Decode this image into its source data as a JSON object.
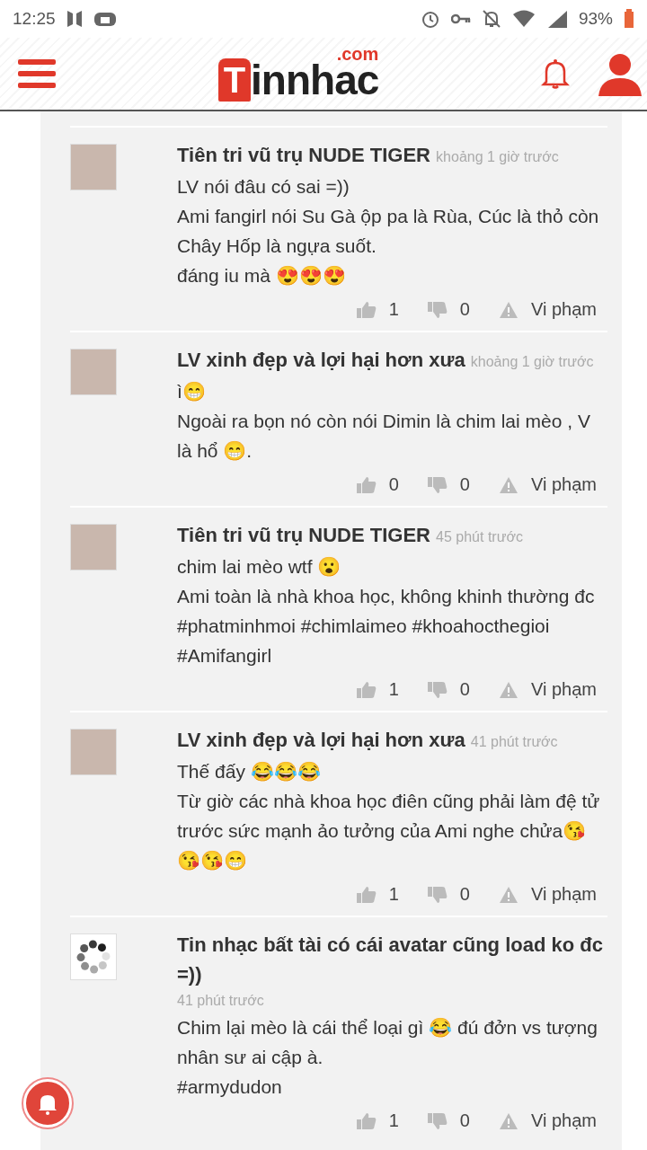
{
  "status_bar": {
    "time": "12:25",
    "battery": "93%"
  },
  "header": {
    "logo": {
      "mark": "T",
      "name": "innhac",
      "suffix": ".com"
    }
  },
  "comments": [
    {
      "author": "Tiên tri vũ trụ NUDE TIGER",
      "time": "khoảng 1 giờ trước",
      "avatar": {
        "kind": "photo"
      },
      "lines": [
        "LV nói đâu có sai =))",
        "Ami fangirl nói Su Gà ộp pa là Rùa, Cúc là thỏ còn Chây Hốp là ngựa suốt.",
        "đáng iu mà 😍😍😍"
      ],
      "likes": "1",
      "dislikes": "0",
      "report": "Vi phạm"
    },
    {
      "author": "LV xinh đẹp và lợi hại hơn xưa",
      "time": "khoảng 1 giờ trước",
      "avatar": {
        "kind": "photo"
      },
      "lines": [
        "ì😁",
        "Ngoài ra bọn nó còn nói Dimin là chim lai mèo , V là hổ 😁."
      ],
      "likes": "0",
      "dislikes": "0",
      "report": "Vi phạm"
    },
    {
      "author": "Tiên tri vũ trụ NUDE TIGER",
      "time": "45 phút trước",
      "avatar": {
        "kind": "photo"
      },
      "lines": [
        "chim lai mèo wtf 😮",
        "Ami toàn là nhà khoa học, không khinh thường đc",
        "#phatminhmoi #chimlaimeo #khoahocthegioi #Amifangirl"
      ],
      "likes": "1",
      "dislikes": "0",
      "report": "Vi phạm"
    },
    {
      "author": "LV xinh đẹp và lợi hại hơn xưa",
      "time": "41 phút trước",
      "avatar": {
        "kind": "photo"
      },
      "lines": [
        "Thế đấy 😂😂😂",
        "Từ giờ các nhà khoa học điên cũng phải làm đệ tử trước sức mạnh ảo tưởng của Ami nghe chửa😘😘😘😁"
      ],
      "likes": "1",
      "dislikes": "0",
      "report": "Vi phạm"
    },
    {
      "author": "Tin nhạc bất tài có cái avatar cũng load ko đc =))",
      "time": "41 phút trước",
      "avatar": {
        "kind": "loading"
      },
      "lines": [
        "Chim lại mèo là cái thể loại gì 😂 đú đởn vs tượng nhân sư ai cập à.",
        "#armydudon"
      ],
      "likes": "1",
      "dislikes": "0",
      "report": "Vi phạm"
    }
  ]
}
